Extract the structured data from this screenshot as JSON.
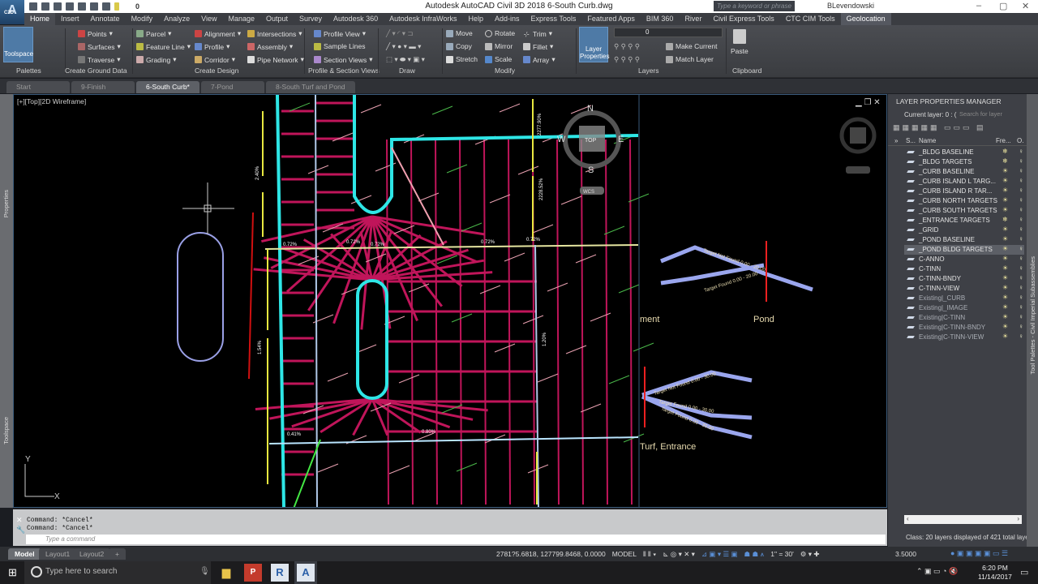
{
  "window": {
    "title": "Autodesk AutoCAD Civil 3D 2018    6-South Curb.dwg",
    "app_badge": "C3D",
    "search_placeholder": "Type a keyword or phrase",
    "user": "BLevendowski",
    "qat_layer": "0"
  },
  "menu_tabs": [
    "Home",
    "Insert",
    "Annotate",
    "Modify",
    "Analyze",
    "View",
    "Manage",
    "Output",
    "Survey",
    "Autodesk 360",
    "Autodesk InfraWorks",
    "Help",
    "Add-ins",
    "Express Tools",
    "Featured Apps",
    "BIM 360",
    "River",
    "Civil Express Tools",
    "CTC CIM Tools",
    "Geolocation"
  ],
  "ribbon": {
    "palettes": {
      "label": "Palettes",
      "toolspace": "Toolspace"
    },
    "ground": {
      "label": "Create Ground Data",
      "items": [
        "Points",
        "Surfaces",
        "Traverse"
      ]
    },
    "design": {
      "label": "Create Design",
      "col1": [
        "Parcel",
        "Feature Line",
        "Grading"
      ],
      "col2": [
        "Alignment",
        "Profile",
        "Corridor"
      ],
      "col3": [
        "Intersections",
        "Assembly",
        "Pipe Network"
      ]
    },
    "profile": {
      "label": "Profile & Section Views",
      "items": [
        "Profile View",
        "Sample Lines",
        "Section Views"
      ]
    },
    "draw": {
      "label": "Draw"
    },
    "modify": {
      "label": "Modify",
      "col1": [
        "Move",
        "Copy",
        "Stretch"
      ],
      "col2": [
        "Rotate",
        "Mirror",
        "Scale"
      ],
      "col3": [
        "Trim",
        "Fillet",
        "Array"
      ]
    },
    "layers": {
      "label": "Layers",
      "layer_properties": "Layer Properties",
      "current": "0",
      "make_current": "Make Current",
      "match_layer": "Match Layer"
    },
    "clipboard": {
      "label": "Clipboard",
      "paste": "Paste"
    }
  },
  "file_tabs": [
    {
      "label": "Start",
      "active": false
    },
    {
      "label": "9-Finish",
      "active": false
    },
    {
      "label": "6-South Curb*",
      "active": true
    },
    {
      "label": "7-Pond",
      "active": false
    },
    {
      "label": "8-South Turf and Pond",
      "active": false
    }
  ],
  "viewport": {
    "label": "[+][Top][2D Wireframe]",
    "viewcube": {
      "n": "N",
      "s": "S",
      "e": "E",
      "w": "W",
      "top": "TOP",
      "wcs": "WCS"
    },
    "annotations": {
      "pond": "Pond",
      "turf_entrance": "Turf, Entrance",
      "partial_label": "ment",
      "target_not_found": "Target Not Found 0.00 - 20.00",
      "target_found": "Target Found 0.00 - 20.00",
      "target_not_found_2": "Target Not Found 0.00 - 30.00",
      "target_found_2": "Target Found 0.00 - 30.00",
      "target_found_3": "Target Found 0.00 - 30.00"
    },
    "slopes": [
      "0.72%",
      "0.72%",
      "0.72%",
      "0.72%",
      "0.72%",
      "0.41%",
      "0.80%",
      "2.40%",
      "1.54%",
      "1.20%",
      "2277.90%",
      "2228.52%"
    ],
    "ucs": {
      "x": "X",
      "y": "Y"
    }
  },
  "side_palettes": {
    "left_top": "Properties",
    "left_bottom": "Toolspace",
    "right": "Tool Palettes - Civil Imperial Subassemblies"
  },
  "layer_manager": {
    "title": "LAYER PROPERTIES MANAGER",
    "current_layer": "Current layer: 0 : (",
    "search_placeholder": "Search for layer",
    "columns": [
      "S...",
      "Name",
      "Fre...",
      "O."
    ],
    "layers": [
      {
        "name": "_BLDG BASELINE",
        "frozen": true,
        "xref": false
      },
      {
        "name": "_BLDG TARGETS",
        "frozen": true,
        "xref": false
      },
      {
        "name": "_CURB BASELINE",
        "frozen": false,
        "xref": false
      },
      {
        "name": "_CURB ISLAND L TARG...",
        "frozen": false,
        "xref": false
      },
      {
        "name": "_CURB ISLAND R TAR...",
        "frozen": false,
        "xref": false
      },
      {
        "name": "_CURB NORTH TARGETS",
        "frozen": false,
        "xref": false
      },
      {
        "name": "_CURB SOUTH TARGETS",
        "frozen": false,
        "xref": false
      },
      {
        "name": "_ENTRANCE TARGETS",
        "frozen": true,
        "xref": false
      },
      {
        "name": "_GRID",
        "frozen": false,
        "xref": false
      },
      {
        "name": "_POND BASELINE",
        "frozen": false,
        "xref": false
      },
      {
        "name": "_POND BLDG TARGETS",
        "frozen": false,
        "xref": false,
        "selected": true
      },
      {
        "name": "C-ANNO",
        "frozen": false,
        "xref": false
      },
      {
        "name": "C-TINN",
        "frozen": false,
        "xref": false
      },
      {
        "name": "C-TINN-BNDY",
        "frozen": false,
        "xref": false
      },
      {
        "name": "C-TINN-VIEW",
        "frozen": false,
        "xref": false
      },
      {
        "name": "Existing|_CURB",
        "frozen": false,
        "xref": true
      },
      {
        "name": "Existing|_IMAGE",
        "frozen": false,
        "xref": true
      },
      {
        "name": "Existing|C-TINN",
        "frozen": false,
        "xref": true
      },
      {
        "name": "Existing|C-TINN-BNDY",
        "frozen": false,
        "xref": true
      },
      {
        "name": "Existing|C-TINN-VIEW",
        "frozen": false,
        "xref": true
      }
    ],
    "status": "Class: 20 layers displayed of 421 total laye"
  },
  "command": {
    "history": [
      "Command: *Cancel*",
      "Command: *Cancel*"
    ],
    "placeholder": "Type a command"
  },
  "layout_tabs": [
    "Model",
    "Layout1",
    "Layout2",
    "+"
  ],
  "status_bar": {
    "coords": "2781?5.6818, 127799.8468, 0.0000",
    "space": "MODEL",
    "scale": "1\" = 30'",
    "precision": "3.5000"
  },
  "taskbar": {
    "search": "Type here to search",
    "time": "6:20 PM",
    "date": "11/14/2017"
  },
  "colors": {
    "accent": "#4e7aa6",
    "curb": "#2ee6e6",
    "grid": "#c0155a",
    "slope": "#e8e840"
  }
}
